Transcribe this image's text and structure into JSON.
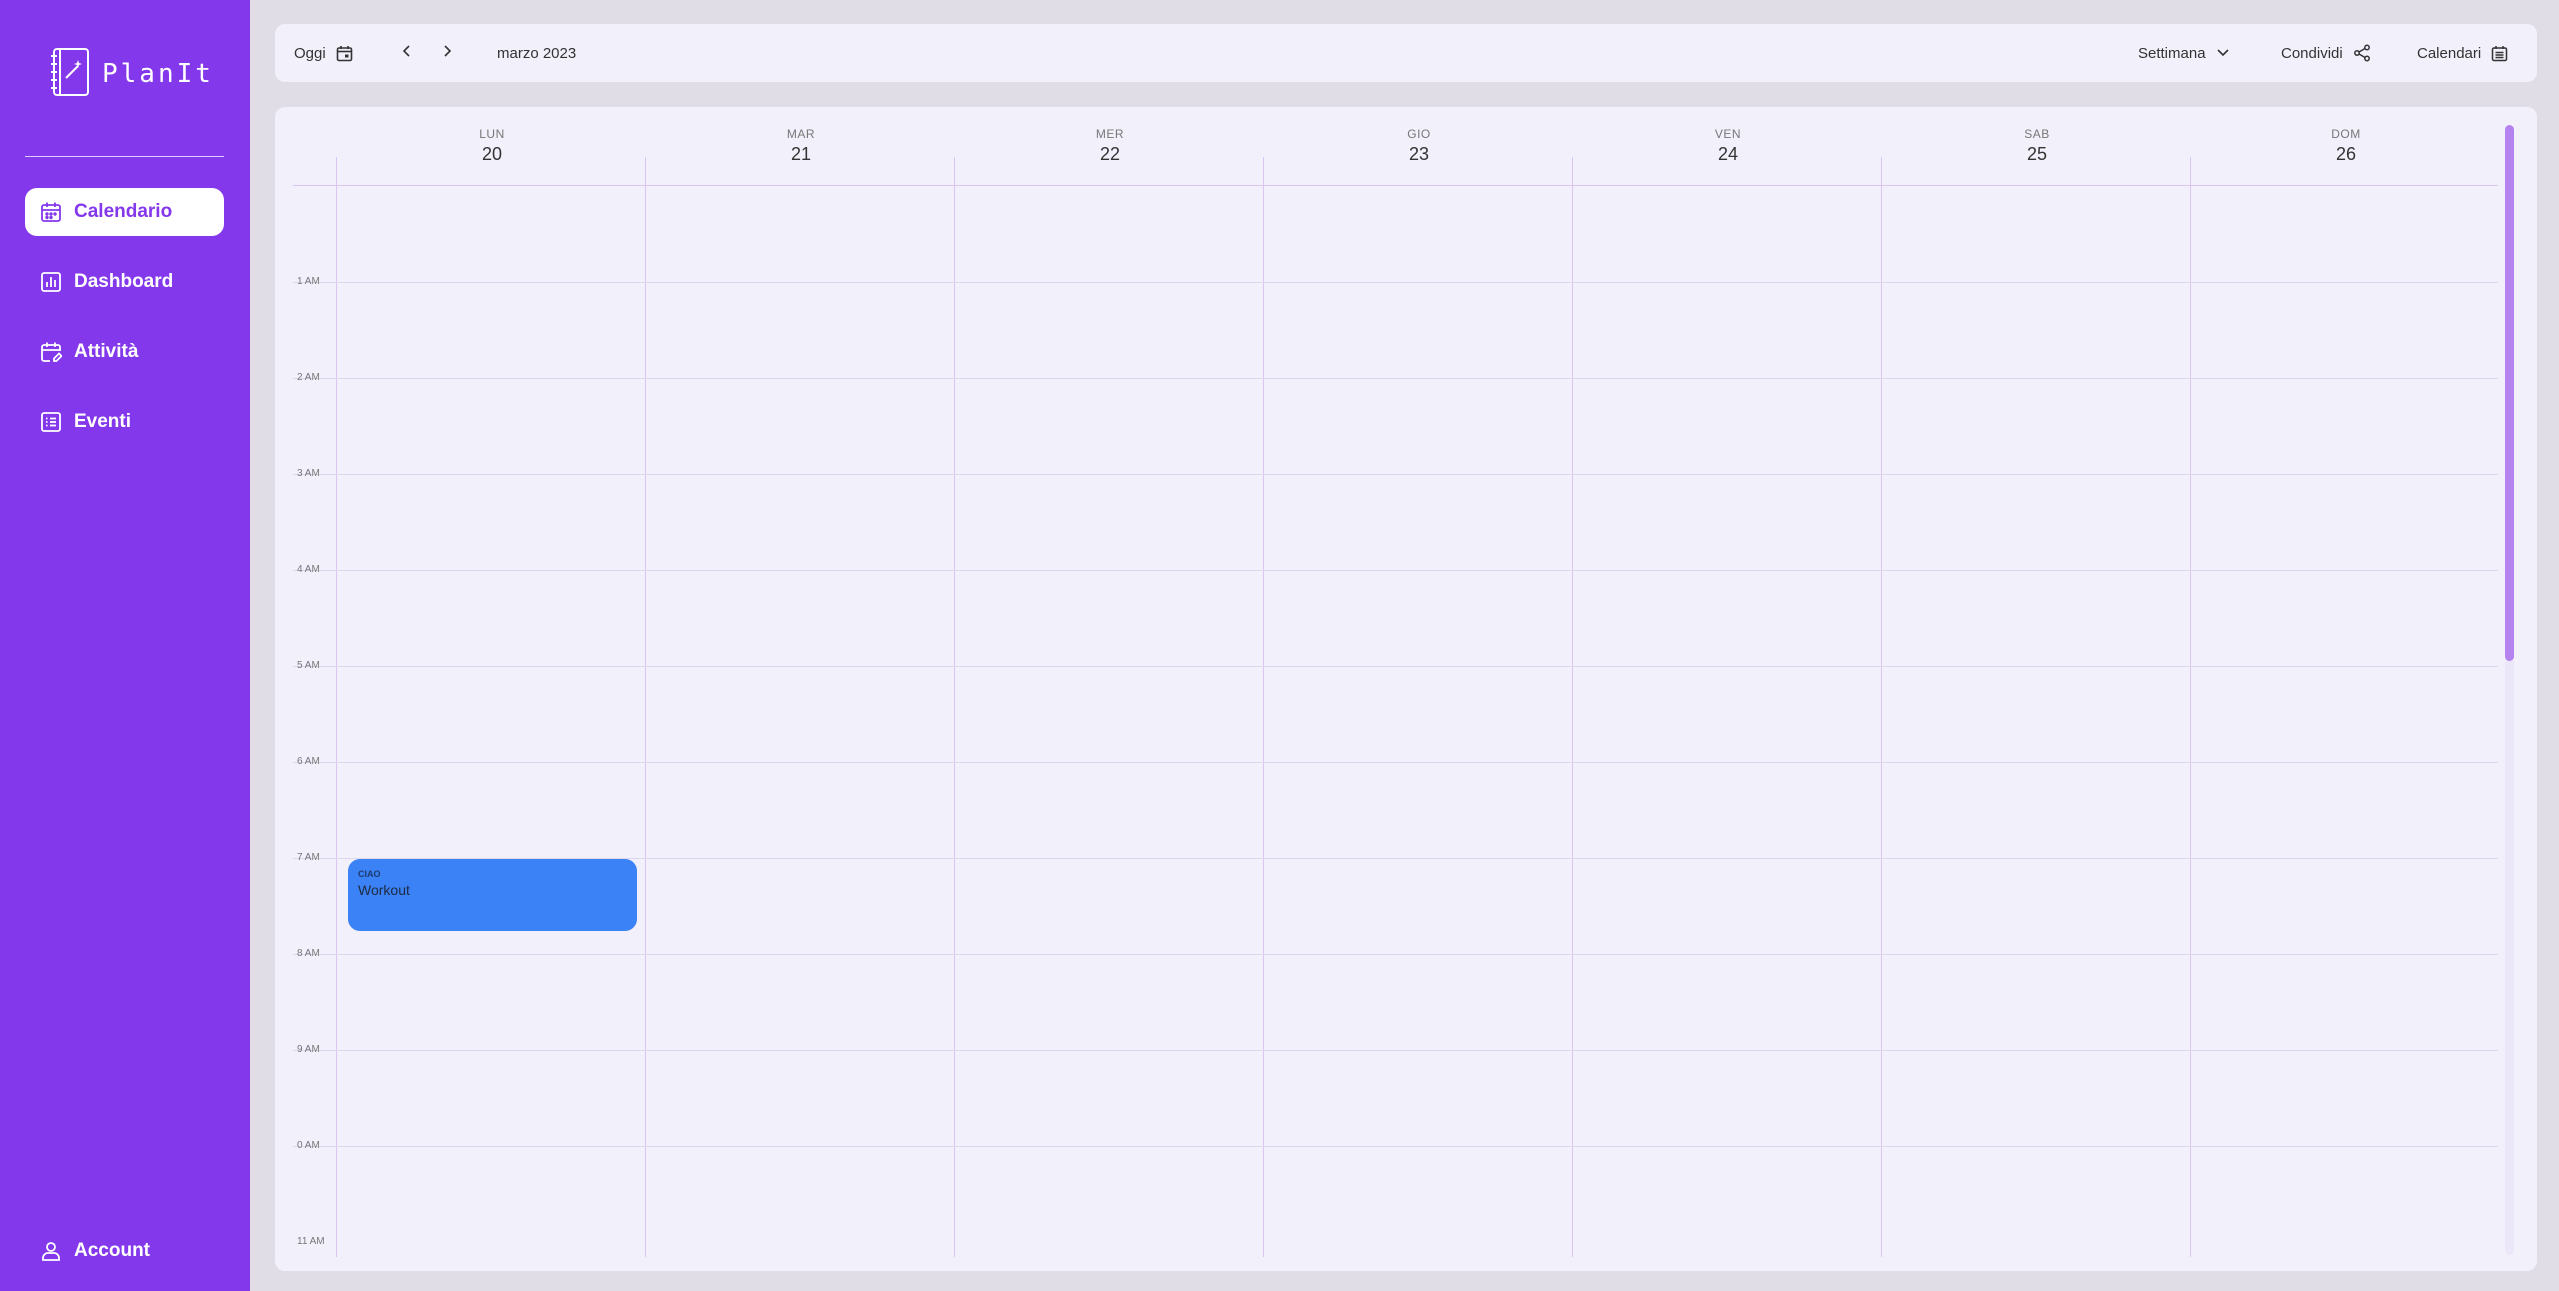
{
  "app": {
    "name": "PlanIt"
  },
  "sidebar": {
    "items": [
      {
        "label": "Calendario",
        "icon": "calendar-icon",
        "active": true
      },
      {
        "label": "Dashboard",
        "icon": "chart-icon",
        "active": false
      },
      {
        "label": "Attività",
        "icon": "task-icon",
        "active": false
      },
      {
        "label": "Eventi",
        "icon": "list-icon",
        "active": false
      }
    ],
    "account_label": "Account"
  },
  "toolbar": {
    "today_label": "Oggi",
    "month_label": "marzo 2023",
    "view_label": "Settimana",
    "share_label": "Condividi",
    "calendars_label": "Calendari"
  },
  "calendar": {
    "days": [
      {
        "name": "LUN",
        "num": "20"
      },
      {
        "name": "MAR",
        "num": "21"
      },
      {
        "name": "MER",
        "num": "22"
      },
      {
        "name": "GIO",
        "num": "23"
      },
      {
        "name": "VEN",
        "num": "24"
      },
      {
        "name": "SAB",
        "num": "25"
      },
      {
        "name": "DOM",
        "num": "26"
      }
    ],
    "hours": [
      "1 AM",
      "2 AM",
      "3 AM",
      "4 AM",
      "5 AM",
      "6 AM",
      "7 AM",
      "8 AM",
      "9 AM",
      "0 AM",
      "11 AM"
    ],
    "event": {
      "tag": "CIAO",
      "title": "Workout",
      "color": "#3b82f6"
    }
  },
  "colors": {
    "accent": "#8438ec",
    "background": "#f1f0fb",
    "event": "#3b82f6"
  }
}
